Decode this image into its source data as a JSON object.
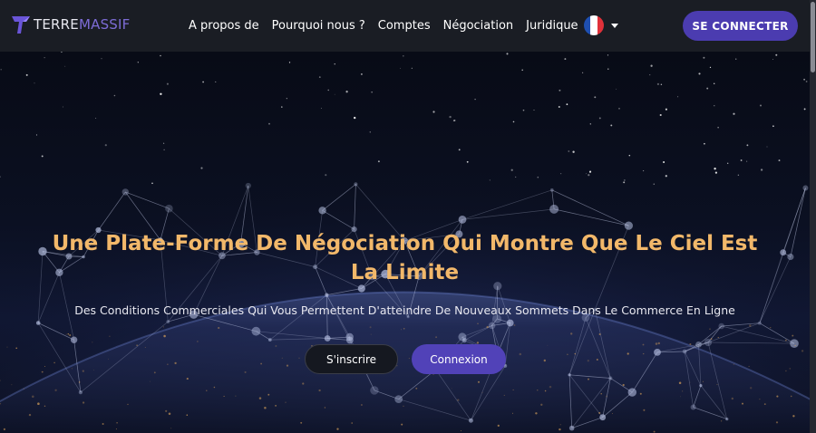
{
  "brand": {
    "name_part1": "TERRE",
    "name_part2": "MASSIF"
  },
  "nav": {
    "links": [
      "A propos de",
      "Pourquoi nous ?",
      "Comptes",
      "Négociation",
      "Juridique"
    ],
    "language": "fr",
    "login_button": "SE CONNECTER"
  },
  "hero": {
    "title": "Une Plate-Forme De Négociation Qui Montre Que Le Ciel Est La Limite",
    "subtitle": "Des Conditions Commerciales Qui Vous Permettent D'atteindre De Nouveaux Sommets Dans Le Commerce En Ligne",
    "signup_button": "S'inscrire",
    "connexion_button": "Connexion"
  },
  "colors": {
    "navbar": "#1a1d24",
    "accent": "#4b3cb0",
    "title": "#f2b86a",
    "flag": [
      "#1f4fb0",
      "#ffffff",
      "#e0313a"
    ]
  }
}
